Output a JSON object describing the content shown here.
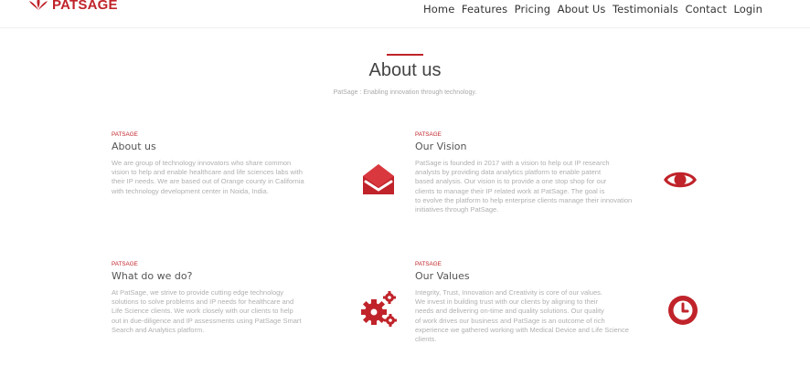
{
  "brand": {
    "name": "PATSAGE",
    "accent_color": "#c0232a",
    "logo_icon": "patsage-leaf-logo"
  },
  "nav": {
    "items": [
      {
        "label": "Home"
      },
      {
        "label": "Features"
      },
      {
        "label": "Pricing"
      },
      {
        "label": "About Us"
      },
      {
        "label": "Testimonials"
      },
      {
        "label": "Contact"
      },
      {
        "label": "Login"
      }
    ]
  },
  "about": {
    "title": "About us",
    "subtitle": "PatSage : Enabling innovation through technology."
  },
  "features": [
    {
      "kicker": "PATSAGE",
      "title": "About us",
      "icon": "envelope-icon",
      "lines": [
        "We are group of technology innovators who share common",
        "vision to help and enable healthcare and life sciences labs with",
        "their IP needs. We are based out of Orange county in California",
        "with technology development center in Noida, India."
      ]
    },
    {
      "kicker": "PATSAGE",
      "title": "Our Vision",
      "icon": "eye-icon",
      "lines": [
        "PatSage is founded in 2017 with a vision to help out IP research",
        "analysts by providing data analytics platform to enable patent",
        "based analysis. Our vision is to provide a one stop shop for our",
        "clients to manage their IP related work at PatSage. The goal is",
        "to evolve the platform to help enterprise clients manage their innovation",
        "initiatives through PatSage."
      ]
    },
    {
      "kicker": "PATSAGE",
      "title": "What do we do?",
      "icon": "gears-icon",
      "lines": [
        "At PatSage, we strive to provide cutting edge technology",
        "solutions to solve problems and IP needs for healthcare and",
        "Life Science clients. We work closely with our clients to help",
        "out in due-diligence and IP assessments using PatSage Smart",
        "Search and Analytics platform."
      ]
    },
    {
      "kicker": "PATSAGE",
      "title": "Our Values",
      "icon": "clock-icon",
      "lines": [
        "Integrity, Trust, Innovation and Creativity is core of our values.",
        "We invest in building trust with our clients by aligning to their",
        "needs and delivering on-time and quality solutions. Our quality",
        "of work drives our business and PatSage is an outcome of rich",
        "experience we gathered working with Medical Device and Life Science",
        "clients."
      ]
    }
  ]
}
